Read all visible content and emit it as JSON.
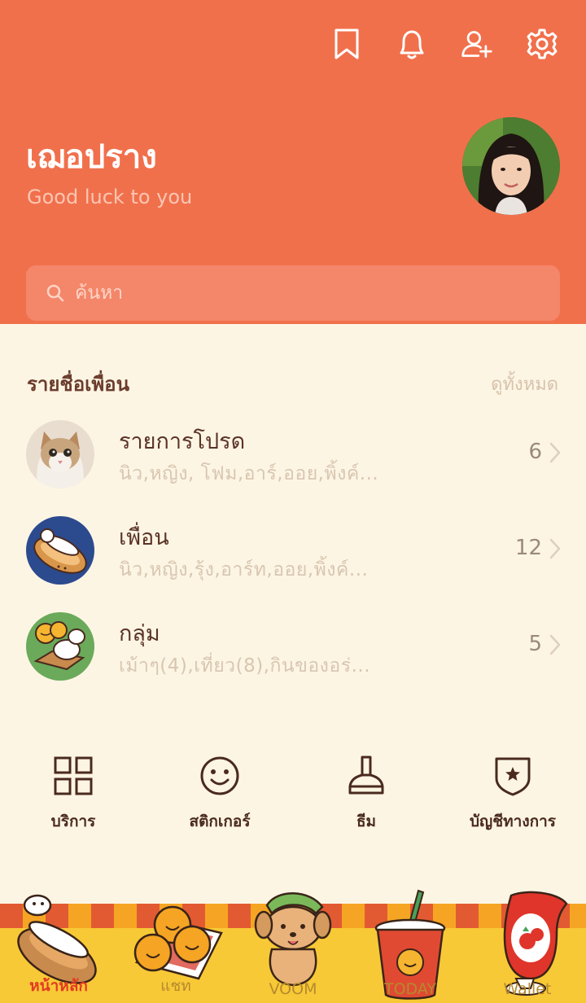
{
  "header": {
    "icons": [
      "bookmark-icon",
      "bell-icon",
      "add-friend-icon",
      "gear-icon"
    ],
    "profile_name": "เฌอปราง",
    "status_message": "Good luck to you",
    "search_placeholder": "ค้นหา"
  },
  "friends": {
    "title": "รายชื่อเพื่อน",
    "see_all": "ดูทั้งหมด",
    "rows": [
      {
        "title": "รายการโปรด",
        "subtitle": "นิว,หญิง, โฟม,อาร์,ออย,พิ้งค์...",
        "count": "6"
      },
      {
        "title": "เพื่อน",
        "subtitle": "นิว,หญิง,รุ้ง,อาร์ท,ออย,พิ้งค์...",
        "count": "12"
      },
      {
        "title": "กลุ่ม",
        "subtitle": "เม้าๆ(4),เที่ยว(8),กินของอร่...",
        "count": "5"
      }
    ]
  },
  "shortcuts": [
    {
      "label": "บริการ",
      "icon": "grid-icon"
    },
    {
      "label": "สติกเกอร์",
      "icon": "smiley-icon"
    },
    {
      "label": "ธีม",
      "icon": "brush-icon"
    },
    {
      "label": "บัญชีทางการ",
      "icon": "shield-star-icon"
    }
  ],
  "bottom_nav": [
    {
      "label": "หน้าหลัก",
      "active": true
    },
    {
      "label": "แชท",
      "active": false
    },
    {
      "label": "VOOM",
      "active": false
    },
    {
      "label": "TODAY",
      "active": false
    },
    {
      "label": "Wallet",
      "active": false
    }
  ],
  "colors": {
    "header_bg": "#f1704c",
    "page_bg": "#fdf5e4",
    "active_tab": "#e33a24"
  }
}
